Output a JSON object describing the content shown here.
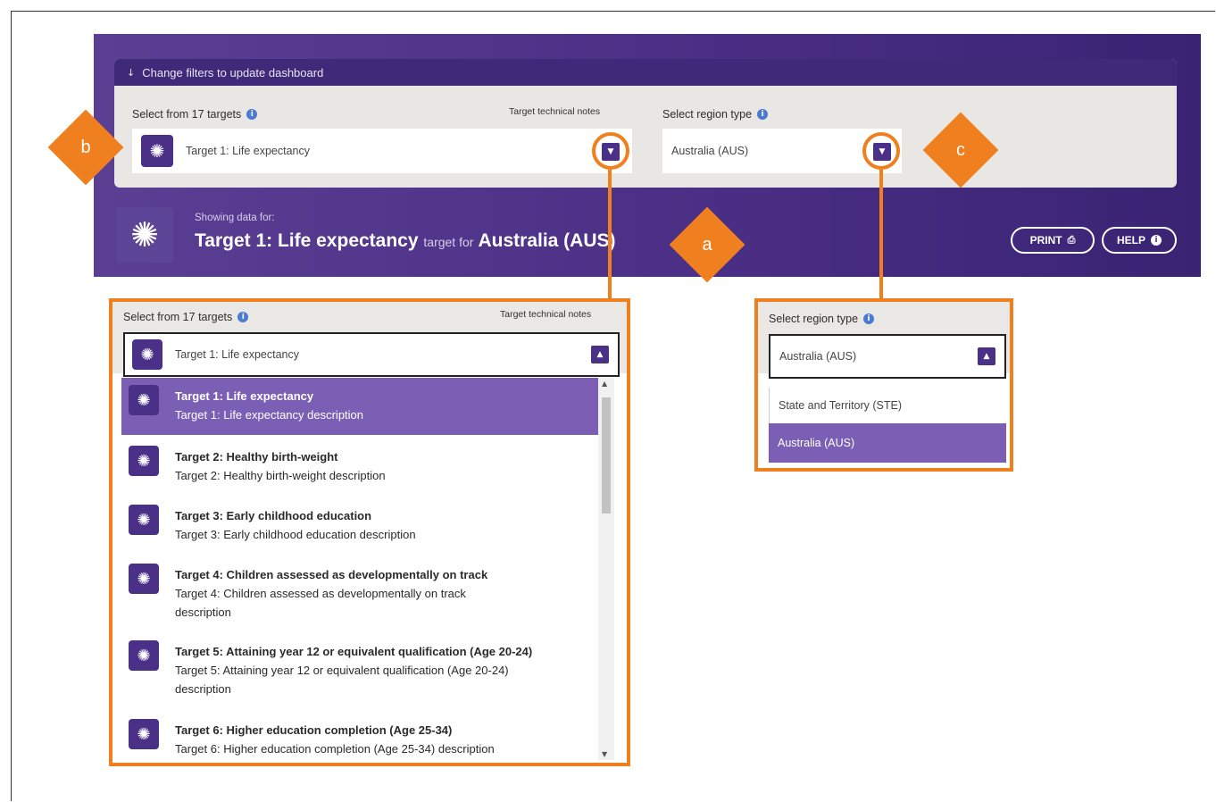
{
  "filters": {
    "header": "Change filters to update dashboard",
    "targets_label": "Select from 17 targets",
    "tech_notes": "Target technical notes",
    "target_value": "Target 1: Life expectancy",
    "region_label": "Select region type",
    "region_value": "Australia (AUS)"
  },
  "showing": {
    "label": "Showing data for:",
    "target": "Target 1: Life expectancy",
    "mid": "target for",
    "region": "Australia (AUS)"
  },
  "buttons": {
    "print": "PRINT",
    "help": "HELP"
  },
  "callouts": {
    "a": "a",
    "b": "b",
    "c": "c"
  },
  "target_dropdown": {
    "label": "Select from 17 targets",
    "tech_notes": "Target technical notes",
    "value": "Target 1: Life expectancy",
    "items": [
      {
        "title": "Target 1: Life expectancy",
        "desc": "Target 1: Life expectancy description",
        "desc2": ""
      },
      {
        "title": "Target 2: Healthy birth-weight",
        "desc": "Target 2: Healthy birth-weight description",
        "desc2": ""
      },
      {
        "title": "Target 3: Early childhood education",
        "desc": "Target 3: Early childhood education description",
        "desc2": ""
      },
      {
        "title": "Target 4: Children assessed as developmentally on track",
        "desc": "Target 4: Children assessed as developmentally on track",
        "desc2": "description"
      },
      {
        "title": "Target 5: Attaining year 12 or equivalent qualification (Age 20-24)",
        "desc": "Target 5: Attaining year 12 or equivalent qualification (Age 20-24)",
        "desc2": "description"
      },
      {
        "title": "Target 6: Higher education completion (Age 25-34)",
        "desc": "Target 6: Higher education completion (Age 25-34) description",
        "desc2": ""
      }
    ]
  },
  "region_dropdown": {
    "label": "Select region type",
    "value": "Australia (AUS)",
    "options": [
      "State and Territory (STE)",
      "Australia (AUS)"
    ]
  },
  "colors": {
    "purple": "#4b3088",
    "orange": "#f07f1e",
    "selected": "#7b5fb5"
  },
  "icons": {
    "target": "sun-icon",
    "dropdown": "caret-icon"
  }
}
